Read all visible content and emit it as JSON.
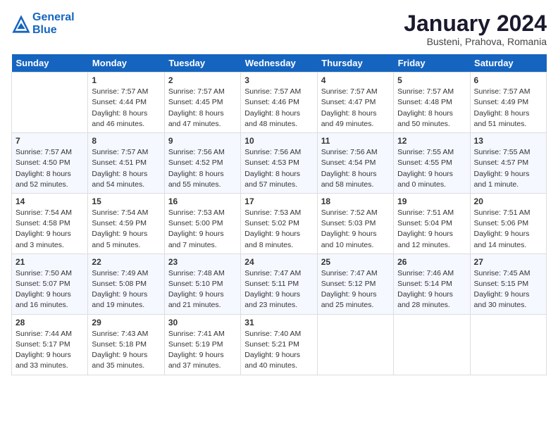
{
  "header": {
    "logo_line1": "General",
    "logo_line2": "Blue",
    "title": "January 2024",
    "subtitle": "Busteni, Prahova, Romania"
  },
  "weekdays": [
    "Sunday",
    "Monday",
    "Tuesday",
    "Wednesday",
    "Thursday",
    "Friday",
    "Saturday"
  ],
  "weeks": [
    [
      {
        "day": "",
        "info": ""
      },
      {
        "day": "1",
        "info": "Sunrise: 7:57 AM\nSunset: 4:44 PM\nDaylight: 8 hours\nand 46 minutes."
      },
      {
        "day": "2",
        "info": "Sunrise: 7:57 AM\nSunset: 4:45 PM\nDaylight: 8 hours\nand 47 minutes."
      },
      {
        "day": "3",
        "info": "Sunrise: 7:57 AM\nSunset: 4:46 PM\nDaylight: 8 hours\nand 48 minutes."
      },
      {
        "day": "4",
        "info": "Sunrise: 7:57 AM\nSunset: 4:47 PM\nDaylight: 8 hours\nand 49 minutes."
      },
      {
        "day": "5",
        "info": "Sunrise: 7:57 AM\nSunset: 4:48 PM\nDaylight: 8 hours\nand 50 minutes."
      },
      {
        "day": "6",
        "info": "Sunrise: 7:57 AM\nSunset: 4:49 PM\nDaylight: 8 hours\nand 51 minutes."
      }
    ],
    [
      {
        "day": "7",
        "info": "Sunrise: 7:57 AM\nSunset: 4:50 PM\nDaylight: 8 hours\nand 52 minutes."
      },
      {
        "day": "8",
        "info": "Sunrise: 7:57 AM\nSunset: 4:51 PM\nDaylight: 8 hours\nand 54 minutes."
      },
      {
        "day": "9",
        "info": "Sunrise: 7:56 AM\nSunset: 4:52 PM\nDaylight: 8 hours\nand 55 minutes."
      },
      {
        "day": "10",
        "info": "Sunrise: 7:56 AM\nSunset: 4:53 PM\nDaylight: 8 hours\nand 57 minutes."
      },
      {
        "day": "11",
        "info": "Sunrise: 7:56 AM\nSunset: 4:54 PM\nDaylight: 8 hours\nand 58 minutes."
      },
      {
        "day": "12",
        "info": "Sunrise: 7:55 AM\nSunset: 4:55 PM\nDaylight: 9 hours\nand 0 minutes."
      },
      {
        "day": "13",
        "info": "Sunrise: 7:55 AM\nSunset: 4:57 PM\nDaylight: 9 hours\nand 1 minute."
      }
    ],
    [
      {
        "day": "14",
        "info": "Sunrise: 7:54 AM\nSunset: 4:58 PM\nDaylight: 9 hours\nand 3 minutes."
      },
      {
        "day": "15",
        "info": "Sunrise: 7:54 AM\nSunset: 4:59 PM\nDaylight: 9 hours\nand 5 minutes."
      },
      {
        "day": "16",
        "info": "Sunrise: 7:53 AM\nSunset: 5:00 PM\nDaylight: 9 hours\nand 7 minutes."
      },
      {
        "day": "17",
        "info": "Sunrise: 7:53 AM\nSunset: 5:02 PM\nDaylight: 9 hours\nand 8 minutes."
      },
      {
        "day": "18",
        "info": "Sunrise: 7:52 AM\nSunset: 5:03 PM\nDaylight: 9 hours\nand 10 minutes."
      },
      {
        "day": "19",
        "info": "Sunrise: 7:51 AM\nSunset: 5:04 PM\nDaylight: 9 hours\nand 12 minutes."
      },
      {
        "day": "20",
        "info": "Sunrise: 7:51 AM\nSunset: 5:06 PM\nDaylight: 9 hours\nand 14 minutes."
      }
    ],
    [
      {
        "day": "21",
        "info": "Sunrise: 7:50 AM\nSunset: 5:07 PM\nDaylight: 9 hours\nand 16 minutes."
      },
      {
        "day": "22",
        "info": "Sunrise: 7:49 AM\nSunset: 5:08 PM\nDaylight: 9 hours\nand 19 minutes."
      },
      {
        "day": "23",
        "info": "Sunrise: 7:48 AM\nSunset: 5:10 PM\nDaylight: 9 hours\nand 21 minutes."
      },
      {
        "day": "24",
        "info": "Sunrise: 7:47 AM\nSunset: 5:11 PM\nDaylight: 9 hours\nand 23 minutes."
      },
      {
        "day": "25",
        "info": "Sunrise: 7:47 AM\nSunset: 5:12 PM\nDaylight: 9 hours\nand 25 minutes."
      },
      {
        "day": "26",
        "info": "Sunrise: 7:46 AM\nSunset: 5:14 PM\nDaylight: 9 hours\nand 28 minutes."
      },
      {
        "day": "27",
        "info": "Sunrise: 7:45 AM\nSunset: 5:15 PM\nDaylight: 9 hours\nand 30 minutes."
      }
    ],
    [
      {
        "day": "28",
        "info": "Sunrise: 7:44 AM\nSunset: 5:17 PM\nDaylight: 9 hours\nand 33 minutes."
      },
      {
        "day": "29",
        "info": "Sunrise: 7:43 AM\nSunset: 5:18 PM\nDaylight: 9 hours\nand 35 minutes."
      },
      {
        "day": "30",
        "info": "Sunrise: 7:41 AM\nSunset: 5:19 PM\nDaylight: 9 hours\nand 37 minutes."
      },
      {
        "day": "31",
        "info": "Sunrise: 7:40 AM\nSunset: 5:21 PM\nDaylight: 9 hours\nand 40 minutes."
      },
      {
        "day": "",
        "info": ""
      },
      {
        "day": "",
        "info": ""
      },
      {
        "day": "",
        "info": ""
      }
    ]
  ]
}
